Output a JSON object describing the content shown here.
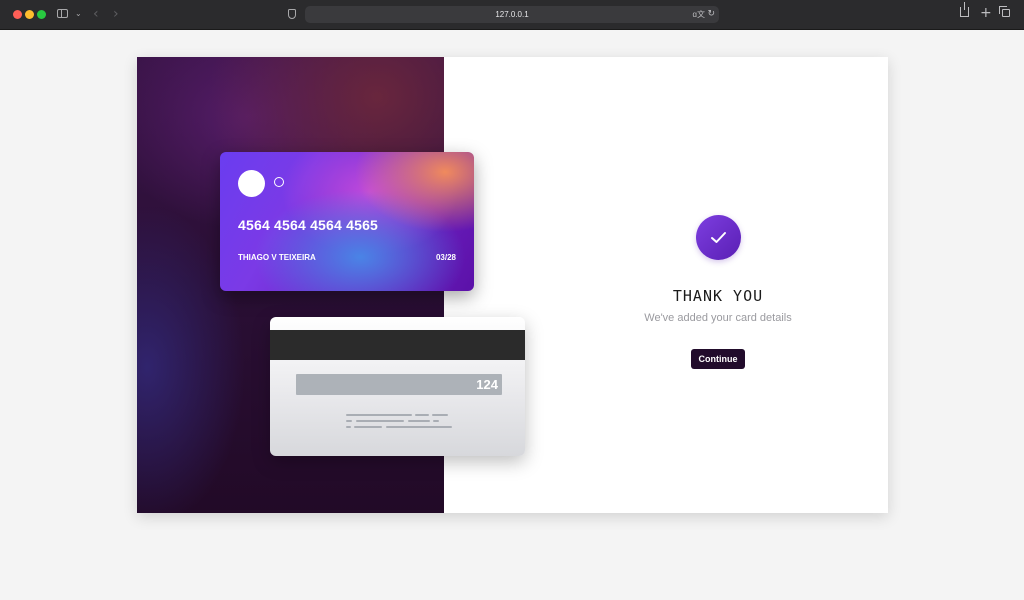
{
  "browser": {
    "url": "127.0.0.1",
    "icons": [
      "sidebar-icon",
      "chevron-down-icon",
      "back-arrow-icon",
      "forward-arrow-icon",
      "shield-icon",
      "translate-icon",
      "reload-icon",
      "share-icon",
      "new-tab-icon",
      "tabs-overview-icon"
    ],
    "nav": {
      "back": "‹",
      "forward": "›",
      "plus": "+",
      "reload": "↻",
      "translate": "ɑ文",
      "chevron": "⌄"
    }
  },
  "card_front": {
    "number": "4564 4564 4564 4565",
    "holder": "THIAGO V TEIXEIRA",
    "expiry": "03/28"
  },
  "card_back": {
    "cvv": "124"
  },
  "confirmation": {
    "title": "THANK YOU",
    "subtitle": "We've added your card details",
    "button_label": "Continue"
  },
  "colors": {
    "accent": "#6a2bd0",
    "button_bg": "#220c2c",
    "hero_bg": "#2a0f35"
  }
}
